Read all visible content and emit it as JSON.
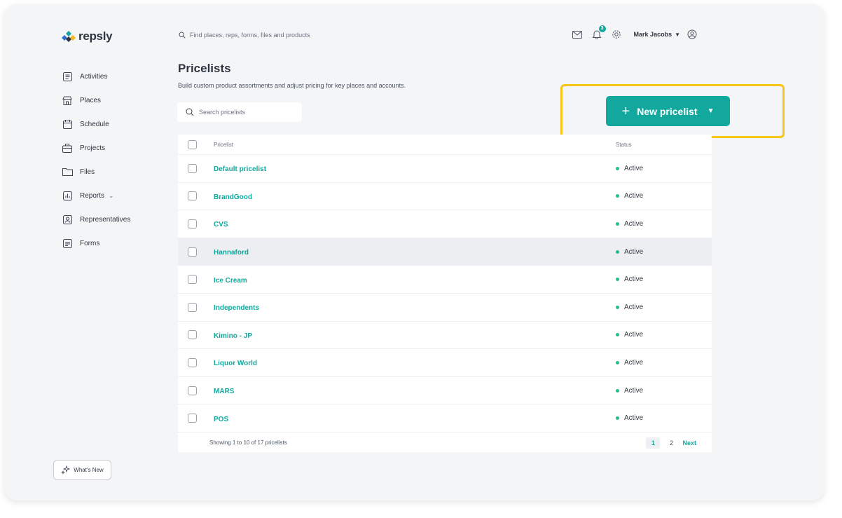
{
  "app": {
    "logo_text": "repsly"
  },
  "header": {
    "search_placeholder": "Find places, reps, forms, files and products",
    "notification_count": "3",
    "user_name": "Mark Jacobs"
  },
  "sidebar": {
    "items": [
      {
        "label": "Activities",
        "icon": "activities-icon"
      },
      {
        "label": "Places",
        "icon": "store-icon"
      },
      {
        "label": "Schedule",
        "icon": "calendar-icon"
      },
      {
        "label": "Projects",
        "icon": "briefcase-icon"
      },
      {
        "label": "Files",
        "icon": "folder-icon"
      },
      {
        "label": "Reports",
        "icon": "chart-icon"
      },
      {
        "label": "Representatives",
        "icon": "user-badge-icon"
      },
      {
        "label": "Forms",
        "icon": "form-icon"
      }
    ],
    "whats_new": "What's New"
  },
  "page": {
    "title": "Pricelists",
    "subtitle": "Build custom product assortments and adjust pricing for key places and accounts.",
    "search_placeholder": "Search pricelists",
    "new_button": "New pricelist"
  },
  "table": {
    "columns": {
      "name": "Pricelist",
      "status": "Status"
    },
    "rows": [
      {
        "name": "Default pricelist",
        "status": "Active"
      },
      {
        "name": "BrandGood",
        "status": "Active"
      },
      {
        "name": "CVS",
        "status": "Active"
      },
      {
        "name": "Hannaford",
        "status": "Active"
      },
      {
        "name": "Ice Cream",
        "status": "Active"
      },
      {
        "name": "Independents",
        "status": "Active"
      },
      {
        "name": "Kimino - JP",
        "status": "Active"
      },
      {
        "name": "Liquor World",
        "status": "Active"
      },
      {
        "name": "MARS",
        "status": "Active"
      },
      {
        "name": "POS",
        "status": "Active"
      }
    ],
    "footer_info": "Showing 1 to 10 of 17 pricelists",
    "pages": [
      "1",
      "2"
    ],
    "next_label": "Next"
  },
  "colors": {
    "accent": "#12a89d",
    "highlight": "#f5c518",
    "active_dot": "#22c08a"
  }
}
